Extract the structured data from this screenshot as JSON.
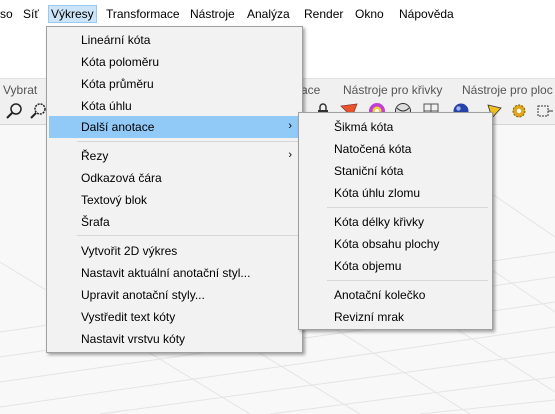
{
  "menubar": {
    "items": [
      "so",
      "Síť",
      "Výkresy",
      "Transformace",
      "Nástroje",
      "Analýza",
      "Render",
      "Okno",
      "Nápověda"
    ]
  },
  "tabs": {
    "left": "Vybrat",
    "middle_partial": "ace",
    "curve_tools": "Nástroje pro křivky",
    "curve_tools_2": "Nástroje pro ploc"
  },
  "menu": {
    "items": [
      {
        "label": "Lineární kóta"
      },
      {
        "label": "Kóta poloměru"
      },
      {
        "label": "Kóta průměru"
      },
      {
        "label": "Kóta úhlu"
      },
      {
        "label": "Další anotace",
        "submenu": true,
        "highlighted": true
      },
      {
        "label": "Řezy",
        "submenu": true
      },
      {
        "label": "Odkazová čára"
      },
      {
        "label": "Textový blok"
      },
      {
        "label": "Šrafa"
      },
      {
        "label": "Vytvořit 2D výkres"
      },
      {
        "label": "Nastavit aktuální anotační styl..."
      },
      {
        "label": "Upravit anotační styly..."
      },
      {
        "label": "Vystředit text kóty"
      },
      {
        "label": "Nastavit vrstvu kóty"
      }
    ],
    "submenu_arrow": "›"
  },
  "submenu": {
    "items": [
      {
        "label": "Šikmá kóta"
      },
      {
        "label": "Natočená kóta"
      },
      {
        "label": "Staniční kóta"
      },
      {
        "label": "Kóta úhlu zlomu"
      },
      {
        "label": "Kóta délky křivky"
      },
      {
        "label": "Kóta obsahu plochy"
      },
      {
        "label": "Kóta objemu"
      },
      {
        "label": "Anotační kolečko"
      },
      {
        "label": "Revizní mrak"
      }
    ]
  },
  "colors": {
    "highlight": "#91c9f7",
    "active_menu": "#cce4f7",
    "menu_bg": "#f2f2f2"
  }
}
